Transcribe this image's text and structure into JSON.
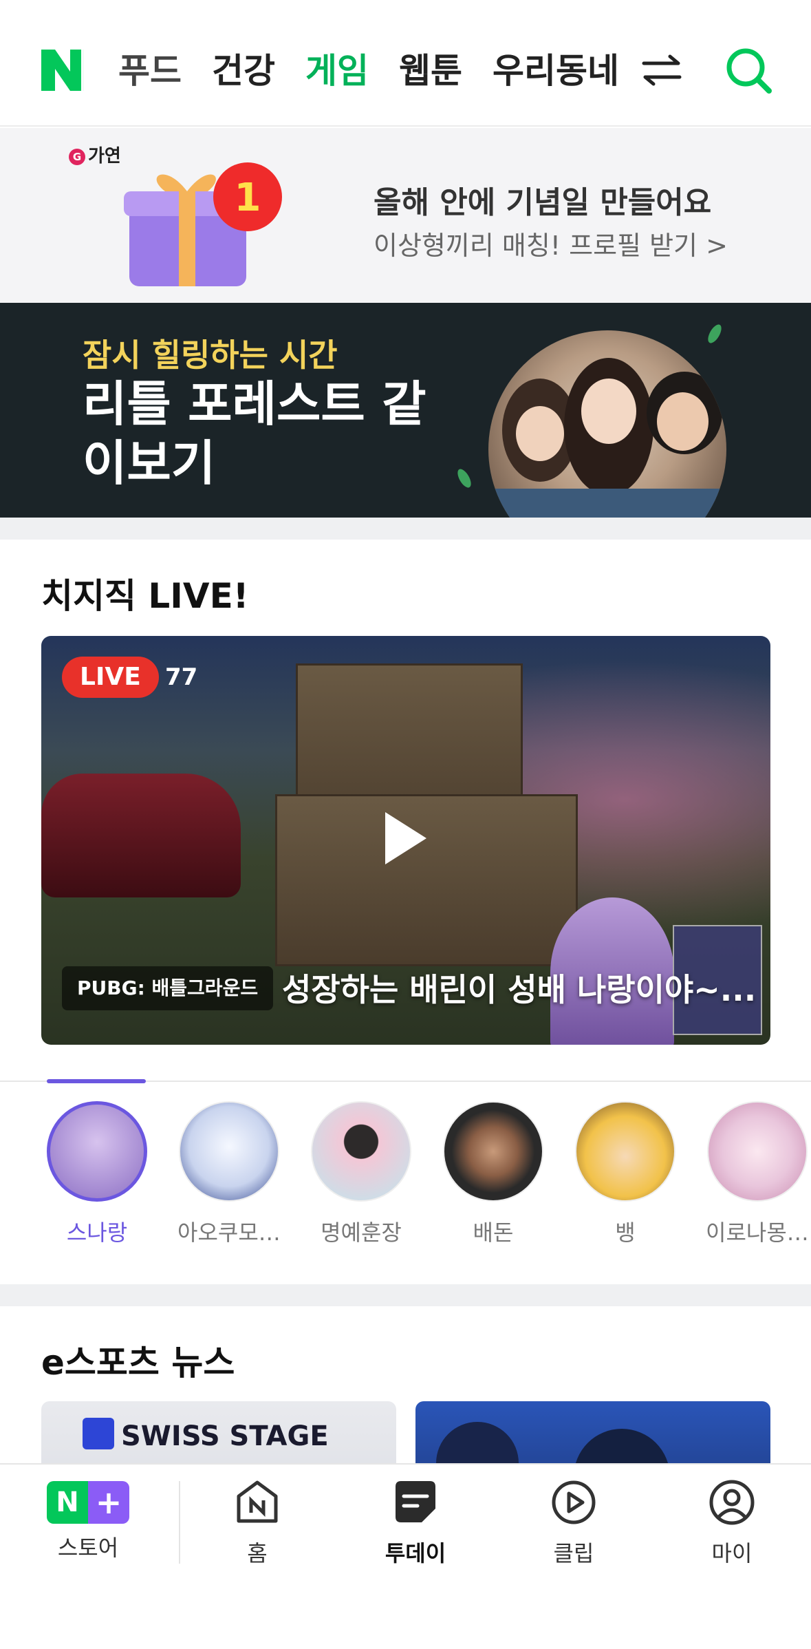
{
  "topnav": {
    "tabs": [
      {
        "label": "푸드"
      },
      {
        "label": "건강"
      },
      {
        "label": "게임"
      },
      {
        "label": "웹툰"
      },
      {
        "label": "우리동네"
      }
    ],
    "active_tab": "게임",
    "accent_color": "#03b159"
  },
  "ad_banner": {
    "brand": "가연",
    "badge_number": "1",
    "title": "올해 안에 기념일 만들어요",
    "subtitle": "이상형끼리 매칭! 프로필 받기 >"
  },
  "movie_banner": {
    "subtitle": "잠시 힐링하는 시간",
    "title": "리틀 포레스트 같이보기"
  },
  "live_section": {
    "title": "치지직 LIVE!",
    "badge": "LIVE",
    "viewer_count": "77",
    "game_tag": "PUBG: 배틀그라운드",
    "stream_title": "성장하는 배린이 성배 나랑이야~...",
    "streamers": [
      {
        "name": "스나랑",
        "active": true,
        "color": "#8c6fc4"
      },
      {
        "name": "아오쿠모 린",
        "active": false,
        "color": "#c9d4ee"
      },
      {
        "name": "명예훈장",
        "active": false,
        "color": "#f3c7d6"
      },
      {
        "name": "배돈",
        "active": false,
        "color": "#2a2a2a"
      },
      {
        "name": "뱅",
        "active": false,
        "color": "#f2c24a"
      },
      {
        "name": "이로나몽 ...",
        "active": false,
        "color": "#e9c6dc"
      }
    ]
  },
  "esports_section": {
    "title": "e스포츠 뉴스",
    "card1_text": "SWISS STAGE"
  },
  "bottomnav": {
    "items": [
      {
        "label": "스토어"
      },
      {
        "label": "홈"
      },
      {
        "label": "투데이"
      },
      {
        "label": "클립"
      },
      {
        "label": "마이"
      }
    ]
  }
}
